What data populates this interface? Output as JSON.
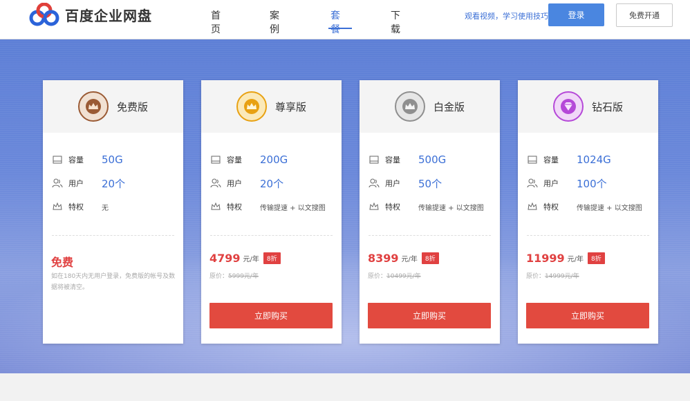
{
  "header": {
    "logo_text": "百度企业网盘",
    "nav": [
      {
        "label": "首页"
      },
      {
        "label": "案例"
      },
      {
        "label": "套餐",
        "active": true
      },
      {
        "label": "下载"
      }
    ],
    "tips": "观看视频，学习使用技巧",
    "login": "登录",
    "free_open": "免费开通"
  },
  "labels": {
    "capacity": "容量",
    "users": "用户",
    "privilege": "特权",
    "buy": "立即购买",
    "unit": "元/年",
    "orig_prefix": "原价："
  },
  "plans": [
    {
      "name": "免费版",
      "badge": "bronze-crown",
      "capacity": "50G",
      "users": "20个",
      "privilege": "无",
      "price": "免费",
      "note": "如在180天内无用户登录，免费版的帐号及数据将被清空。"
    },
    {
      "name": "尊享版",
      "badge": "gold-crown",
      "capacity": "200G",
      "users": "20个",
      "privilege": "传输提速 + 以文搜图",
      "price": "4799",
      "discount": "8折",
      "orig_price": "5999元/年"
    },
    {
      "name": "白金版",
      "badge": "platinum-crown",
      "capacity": "500G",
      "users": "50个",
      "privilege": "传输提速 + 以文搜图",
      "price": "8399",
      "discount": "8折",
      "orig_price": "10499元/年"
    },
    {
      "name": "钻石版",
      "badge": "diamond",
      "capacity": "1024G",
      "users": "100个",
      "privilege": "传输提速 + 以文搜图",
      "price": "11999",
      "discount": "8折",
      "orig_price": "14999元/年"
    }
  ],
  "colors": {
    "accent": "#3b6fd6",
    "price": "#e04141",
    "buy_button": "#e24a3f",
    "bronze": "#9a5a34",
    "gold": "#e8a112",
    "platinum": "#8f8f8f",
    "diamond": "#b548d8"
  }
}
